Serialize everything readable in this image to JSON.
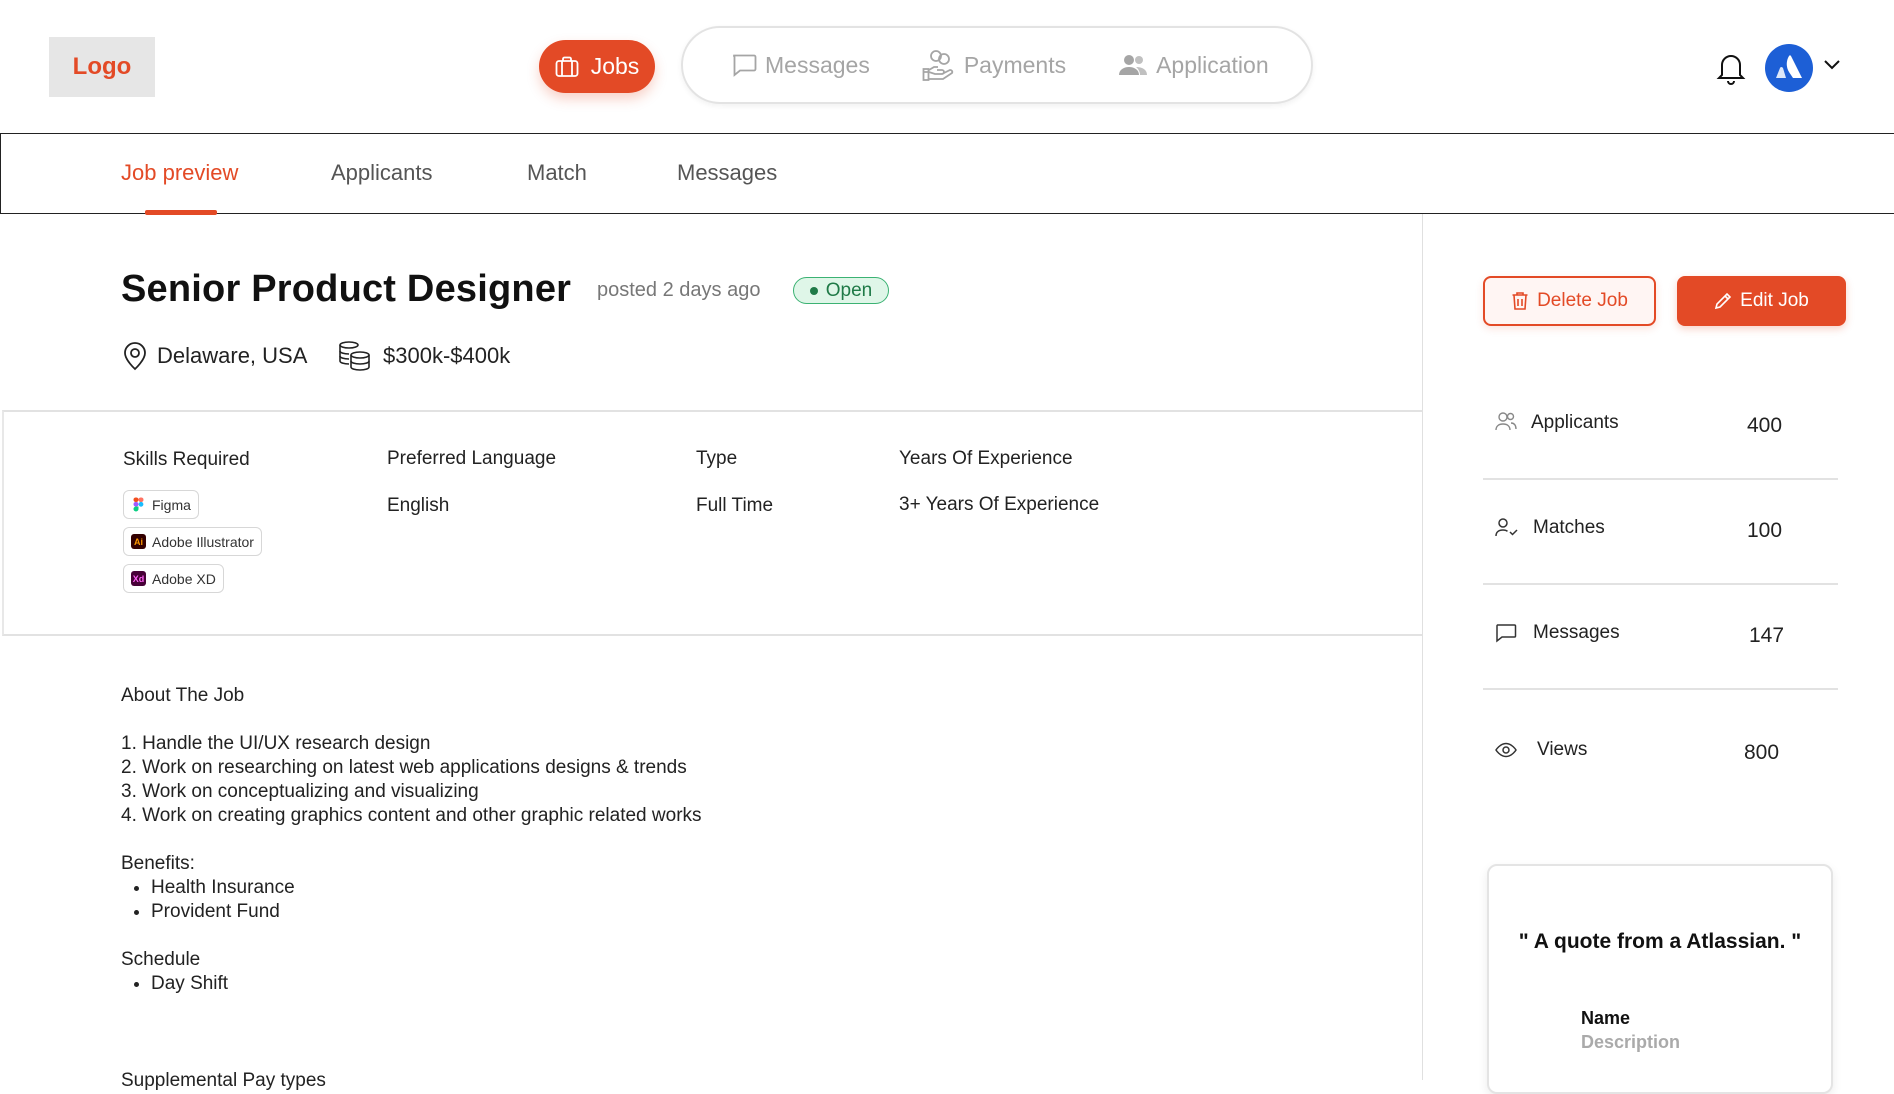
{
  "header": {
    "logo": "Logo",
    "nav_active": {
      "label": "Jobs",
      "icon": "briefcase-icon"
    },
    "nav_items": [
      {
        "label": "Messages",
        "icon": "message-icon"
      },
      {
        "label": "Payments",
        "icon": "payments-icon"
      },
      {
        "label": "Application",
        "icon": "users-icon"
      }
    ],
    "accent": "#e34a26",
    "avatar_brand": "Atlassian"
  },
  "tabs": [
    {
      "label": "Job preview",
      "active": true
    },
    {
      "label": "Applicants",
      "active": false
    },
    {
      "label": "Match",
      "active": false
    },
    {
      "label": "Messages",
      "active": false
    }
  ],
  "job": {
    "title": "Senior Product Designer",
    "posted": "posted 2 days ago",
    "status": "Open",
    "location": "Delaware, USA",
    "salary": "$300k-$400k"
  },
  "details": {
    "skills_label": "Skills Required",
    "skills": [
      "Figma",
      "Adobe Illustrator",
      "Adobe XD"
    ],
    "language_label": "Preferred Language",
    "language": "English",
    "type_label": "Type",
    "type": "Full Time",
    "experience_label": "Years Of Experience",
    "experience": "3+ Years Of Experience"
  },
  "about": {
    "heading": "About The Job",
    "items": [
      "1. Handle the UI/UX research design",
      "2. Work on researching on latest web applications designs & trends",
      "3. Work on conceptualizing and visualizing",
      "4. Work on creating graphics content and other graphic related works"
    ],
    "benefits_heading": "Benefits:",
    "benefits": [
      "Health Insurance",
      "Provident Fund"
    ],
    "schedule_heading": "Schedule",
    "schedule": [
      "Day Shift"
    ],
    "supplemental_heading": "Supplemental Pay types"
  },
  "actions": {
    "delete": "Delete Job",
    "edit": "Edit Job"
  },
  "stats": [
    {
      "label": "Applicants",
      "value": "400",
      "icon": "users-icon"
    },
    {
      "label": "Matches",
      "value": "100",
      "icon": "user-check-icon"
    },
    {
      "label": "Messages",
      "value": "147",
      "icon": "message-icon"
    },
    {
      "label": "Views",
      "value": "800",
      "icon": "eye-icon"
    }
  ],
  "quote": {
    "text": "\" A quote from a Atlassian. \"",
    "name": "Name",
    "description": "Description"
  }
}
